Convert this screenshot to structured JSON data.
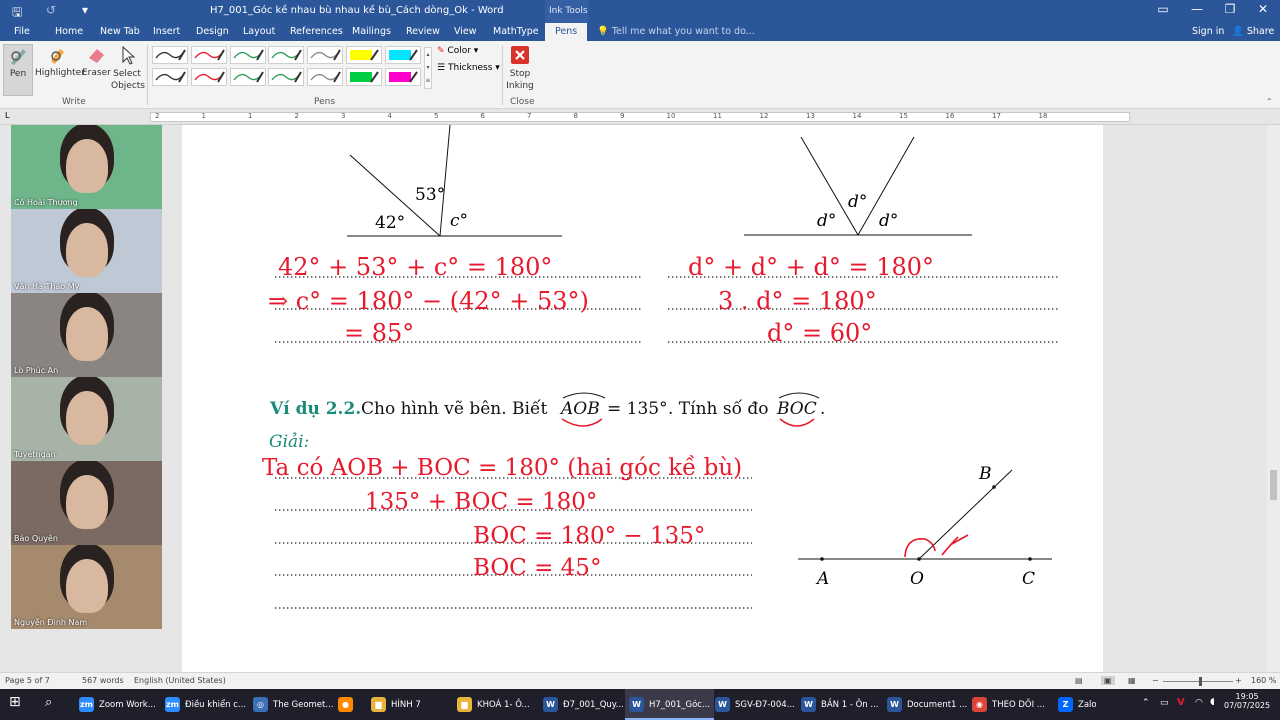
{
  "titlebar": {
    "doc_title": "H7_001_Góc kề nhau bù nhau kề bù_Cách dòng_Ok - Word",
    "contextual_group": "Ink Tools"
  },
  "tabs": [
    "File",
    "Home",
    "New Tab",
    "Insert",
    "Design",
    "Layout",
    "References",
    "Mailings",
    "Review",
    "View",
    "MathType",
    "Pens"
  ],
  "active_tab": "Pens",
  "tell_me": "Tell me what you want to do...",
  "sign_in": "Sign in",
  "share": "Share",
  "ribbon": {
    "write": {
      "pen": "Pen",
      "highlighter": "Highlighter",
      "eraser": "Eraser",
      "select_objects": "Select Objects",
      "group": "Write"
    },
    "pens_group": "Pens",
    "color": "Color",
    "thickness": "Thickness",
    "stop_inking": "Stop Inking",
    "close_group": "Close",
    "pen_colors": [
      "#333333",
      "#e8192c",
      "#2e9a59",
      "#2e9a59",
      "#888888",
      "#ffff00",
      "#00e5ff",
      "#333333",
      "#e8192c",
      "#2e9a59",
      "#2e9a59",
      "#888888",
      "#00cc44",
      "#ff00cc"
    ]
  },
  "ruler_numbers": [
    "2",
    "1",
    "1",
    "2",
    "3",
    "4",
    "5",
    "6",
    "7",
    "8",
    "9",
    "10",
    "11",
    "12",
    "13",
    "14",
    "15",
    "16",
    "17",
    "18"
  ],
  "participants": [
    {
      "name": "Cô Hoài Thương",
      "bg": "#6fb58a"
    },
    {
      "name": "Văn Hà Thảo My",
      "bg": "#bfc9d6"
    },
    {
      "name": "Lò Phúc An",
      "bg": "#8a8580"
    },
    {
      "name": "Tuyetngan",
      "bg": "#a7b3a6"
    },
    {
      "name": "Bảo Quyên",
      "bg": "#7b6a62"
    },
    {
      "name": "Nguyễn Đình Nam",
      "bg": "#a58a6e"
    }
  ],
  "document": {
    "fig1": {
      "a": "53°",
      "b": "42°",
      "c": "c°"
    },
    "fig2": {
      "top": "d°",
      "left": "d°",
      "right": "d°"
    },
    "hw_left": [
      "42° + 53° + c° = 180°",
      "⇒ c° = 180° − (42° + 53°)",
      "= 85°"
    ],
    "hw_right": [
      "d° + d° + d° = 180°",
      "3 . d° = 180°",
      "d° = 60°"
    ],
    "example_label": "Ví dụ 2.2.",
    "example_text": "Cho hình vẽ bên. Biết",
    "angle_aob": "AOB",
    "equals_135": "= 135°",
    "compute_text": ". Tính số đo",
    "angle_boc": "BOC",
    "period": ".",
    "solution_label": "Giải:",
    "hw_solution": [
      "Ta có AOB + BOC = 180° (hai góc kề bù)",
      "135° + BOC = 180°",
      "BOC = 180° − 135°",
      "BOC = 45°"
    ],
    "fig3": {
      "a": "A",
      "o": "O",
      "c": "C",
      "b": "B"
    }
  },
  "status": {
    "page": "Page 5 of 7",
    "words": "567 words",
    "language": "English (United States)",
    "zoom": "160 %"
  },
  "taskbar": {
    "items": [
      {
        "label": "Zoom Work...",
        "color": "#2d8cff",
        "glyph": "zm"
      },
      {
        "label": "Điều khiển c...",
        "color": "#2d8cff",
        "glyph": "zm"
      },
      {
        "label": "The Geomet...",
        "color": "#3b6fb6",
        "glyph": "◎"
      },
      {
        "label": "",
        "color": "#ff8a00",
        "glyph": "●"
      },
      {
        "label": "HÌNH 7",
        "color": "#e8b53a",
        "glyph": "▆"
      },
      {
        "label": "KHOÁ 1- Ô...",
        "color": "#e8b53a",
        "glyph": "▆"
      },
      {
        "label": "Đ7_001_Quy...",
        "color": "#2b579a",
        "glyph": "W"
      },
      {
        "label": "H7_001_Góc...",
        "color": "#2b579a",
        "glyph": "W"
      },
      {
        "label": "SGV-Đ7-004...",
        "color": "#2b579a",
        "glyph": "W"
      },
      {
        "label": "BẢN 1 - Ôn ...",
        "color": "#2b579a",
        "glyph": "W"
      },
      {
        "label": "Document1 ...",
        "color": "#2b579a",
        "glyph": "W"
      },
      {
        "label": "THEO DÕI ...",
        "color": "#db4437",
        "glyph": "◉"
      },
      {
        "label": "Zalo",
        "color": "#0068ff",
        "glyph": "Z"
      }
    ],
    "time": "19:05",
    "date": "07/07/2025"
  }
}
